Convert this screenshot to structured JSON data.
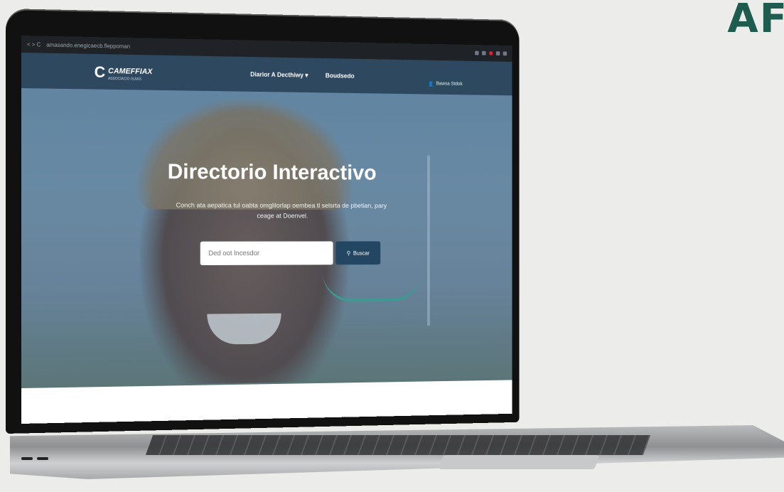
{
  "corner": {
    "text": "AF"
  },
  "browser": {
    "controls": "< > C",
    "url": "amasando.enegicaecb.fleppoman",
    "colors": {
      "toolbar": "#1f2327"
    }
  },
  "header": {
    "logo": {
      "mark": "C",
      "name": "CAMEFFIAX",
      "sub": "ASSOCIACIO GUIAS"
    },
    "menu": [
      {
        "label": "Diarior A Decthiwy ▾"
      },
      {
        "label": "Boudsedo"
      }
    ],
    "action_button": {
      "icon": "user-icon",
      "label": "Bawsa Stdok"
    }
  },
  "hero": {
    "title": "Directorio Interactivo",
    "subtitle": "Conch ata aepatica tul oabta omglilorlap oembea tl selsrta de pbetian, pary ceage at Doenvel.",
    "search": {
      "placeholder": "Ded oot lncesdor",
      "button_label": "Buscar",
      "button_icon": "search-icon"
    },
    "colors": {
      "accent": "#234763",
      "arc": "#3c9a92"
    }
  }
}
